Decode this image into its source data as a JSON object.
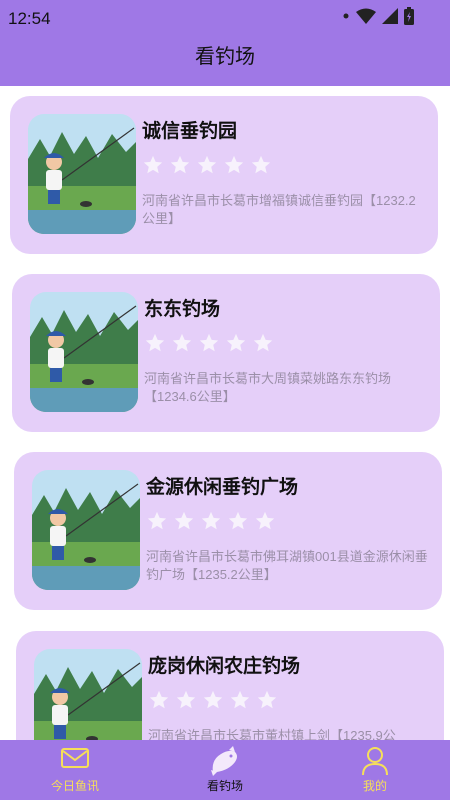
{
  "statusbar": {
    "time": "12:54"
  },
  "appbar": {
    "title": "看钓场"
  },
  "colors": {
    "accent": "#9f78e6",
    "card": "#e5cff9",
    "inactive_tab": "#f6df59"
  },
  "spots": [
    {
      "name": "诚信垂钓园",
      "address": "河南省许昌市长葛市增福镇诚信垂钓园【1232.2公里】",
      "rating": 5
    },
    {
      "name": "东东钓场",
      "address": "河南省许昌市长葛市大周镇菜姚路东东钓场【1234.6公里】",
      "rating": 5
    },
    {
      "name": "金源休闲垂钓广场",
      "address": "河南省许昌市长葛市佛耳湖镇001县道金源休闲垂钓广场【1235.2公里】",
      "rating": 5
    },
    {
      "name": "庞岗休闲农庄钓场",
      "address": "河南省许昌市长葛市董村镇上剑【1235.9公",
      "rating": 5
    }
  ],
  "tabs": [
    {
      "label": "今日鱼讯",
      "icon": "mail-icon",
      "active": false
    },
    {
      "label": "看钓场",
      "icon": "fish-icon",
      "active": true
    },
    {
      "label": "我的",
      "icon": "person-icon",
      "active": false
    }
  ]
}
